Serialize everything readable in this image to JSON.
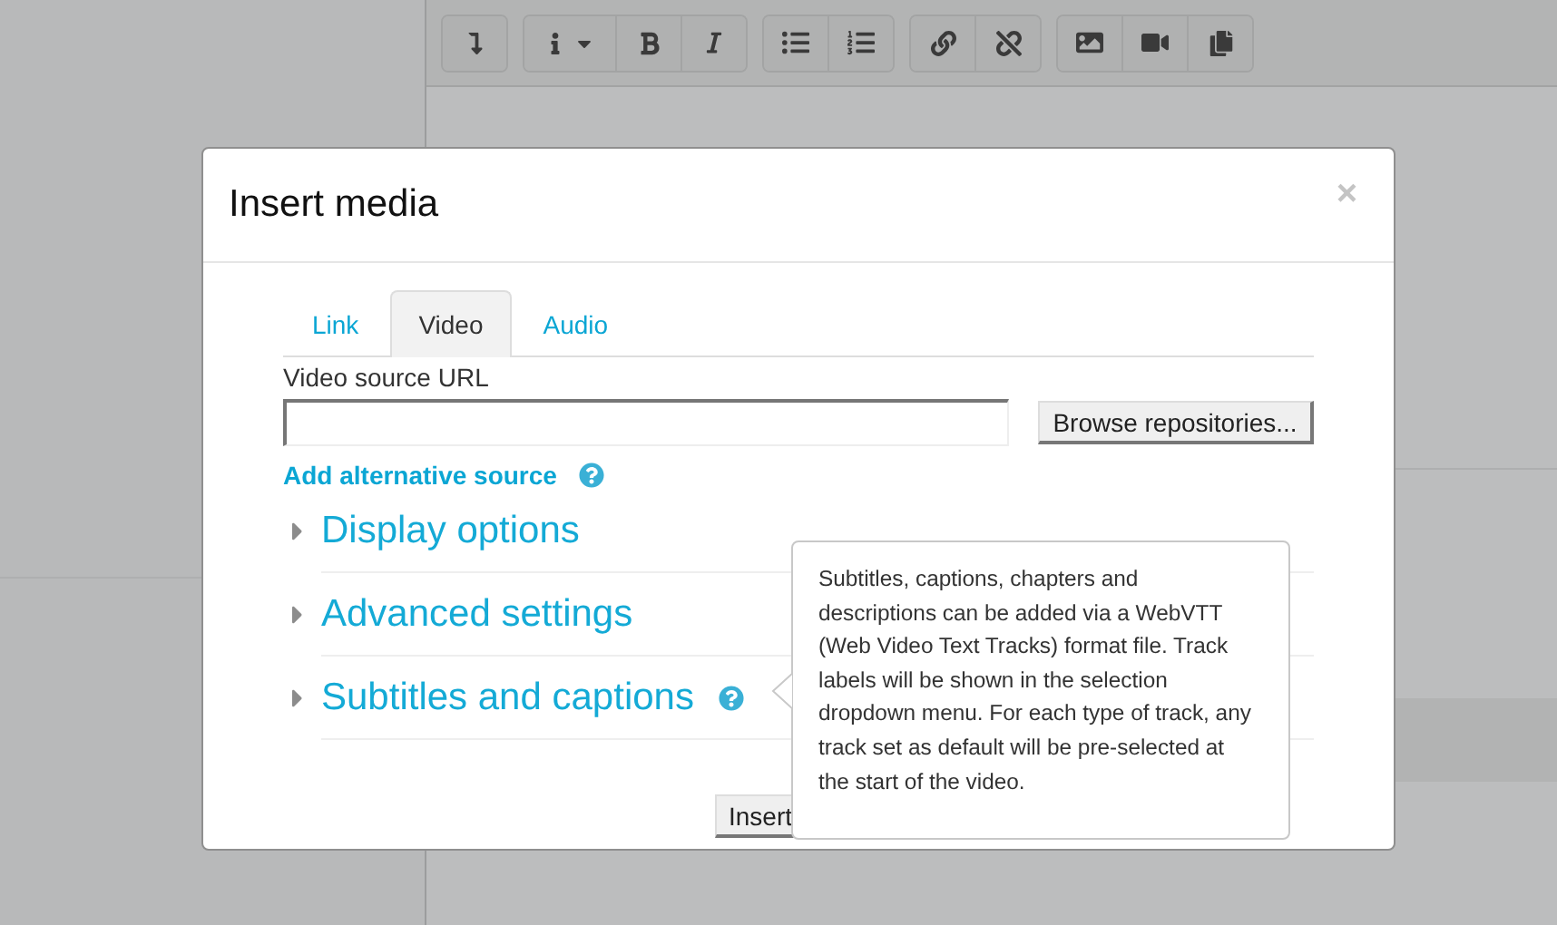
{
  "dialog": {
    "title": "Insert media",
    "close": "×",
    "tabs": [
      {
        "label": "Link",
        "selected": false
      },
      {
        "label": "Video",
        "selected": true
      },
      {
        "label": "Audio",
        "selected": false
      }
    ],
    "url_field": {
      "label": "Video source URL"
    },
    "browse_button": "Browse repositories...",
    "add_source_link": {
      "label": "Add alternative source",
      "has_help": true
    },
    "sections": [
      {
        "title": "Display options",
        "expanded": false,
        "has_help": false
      },
      {
        "title": "Advanced settings",
        "expanded": false,
        "has_help": false
      },
      {
        "title": "Subtitles and captions",
        "expanded": false,
        "has_help": true
      }
    ],
    "insert_button": "Insert",
    "tooltip": "Subtitles, captions, chapters and descriptions can be added via a WebVTT (Web Video Text Tracks) format file. Track labels will be shown in the selection dropdown menu. For each type of track, any track set as default will be pre-selected at the start of the video."
  }
}
